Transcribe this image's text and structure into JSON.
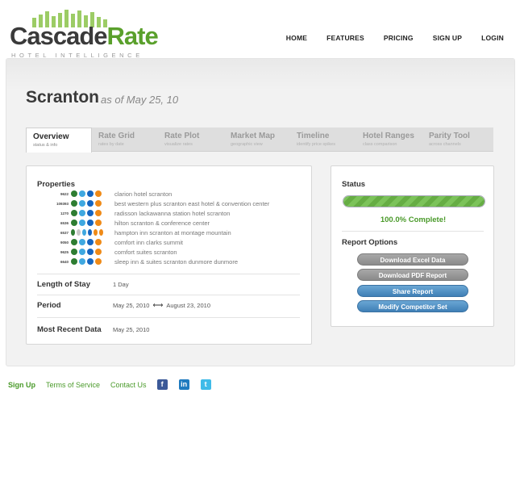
{
  "brand": {
    "name_part1": "Cascade",
    "name_part2": "Rate",
    "tagline": "HOTEL INTELLIGENCE",
    "accent_color": "#5aa02c"
  },
  "nav": {
    "items": [
      "HOME",
      "FEATURES",
      "PRICING",
      "SIGN UP",
      "LOGIN"
    ]
  },
  "page": {
    "city": "Scranton",
    "as_of": "as of May 25, 10"
  },
  "tabs": [
    {
      "title": "Overview",
      "sub": "status & info"
    },
    {
      "title": "Rate Grid",
      "sub": "rates by date"
    },
    {
      "title": "Rate Plot",
      "sub": "visualize rates"
    },
    {
      "title": "Market Map",
      "sub": "geographic view"
    },
    {
      "title": "Timeline",
      "sub": "identify price spikes"
    },
    {
      "title": "Hotel Ranges",
      "sub": "class comparison"
    },
    {
      "title": "Parity Tool",
      "sub": "across channels"
    }
  ],
  "info": {
    "properties_label": "Properties",
    "properties": [
      {
        "id": "9622",
        "name": "clarion hotel scranton",
        "circles": [
          "e",
          "t",
          "b",
          "o"
        ]
      },
      {
        "id": "109393",
        "name": "best western plus scranton east hotel & convention center",
        "circles": [
          "e",
          "t",
          "b",
          "o"
        ]
      },
      {
        "id": "1270",
        "name": "radisson lackawanna station hotel scranton",
        "circles": [
          "e",
          "t",
          "b",
          "o"
        ]
      },
      {
        "id": "6536",
        "name": "hilton scranton & conference center",
        "circles": [
          "e",
          "t",
          "b",
          "o"
        ]
      },
      {
        "id": "6537",
        "name": "hampton inn scranton at montage mountain",
        "circles": [
          "e",
          "g",
          "t",
          "b",
          "o",
          "o"
        ]
      },
      {
        "id": "9050",
        "name": "comfort inn clarks summit",
        "circles": [
          "e",
          "t",
          "b",
          "o"
        ]
      },
      {
        "id": "9625",
        "name": "comfort suites scranton",
        "circles": [
          "e",
          "t",
          "b",
          "o"
        ]
      },
      {
        "id": "6640",
        "name": "sleep inn & suites scranton dunmore dunmore",
        "circles": [
          "e",
          "t",
          "b",
          "o"
        ]
      }
    ],
    "length_of_stay_label": "Length of Stay",
    "length_of_stay": "1 Day",
    "period_label": "Period",
    "period_start": "May 25, 2010",
    "period_arrow": "⟷",
    "period_end": "August 23, 2010",
    "recent_label": "Most Recent Data",
    "recent_value": "May 25, 2010"
  },
  "status": {
    "label": "Status",
    "progress_percent": 100,
    "complete_text": "100.0% Complete!",
    "options_label": "Report Options",
    "buttons": [
      "Download Excel Data",
      "Download PDF Report",
      "Share Report",
      "Modify Competitor Set"
    ]
  },
  "footer": {
    "links": [
      "Sign Up",
      "Terms of Service",
      "Contact Us"
    ],
    "social": [
      {
        "icon": "facebook-icon",
        "glyph": "f"
      },
      {
        "icon": "linkedin-icon",
        "glyph": "in"
      },
      {
        "icon": "twitter-icon",
        "glyph": "t"
      }
    ]
  }
}
